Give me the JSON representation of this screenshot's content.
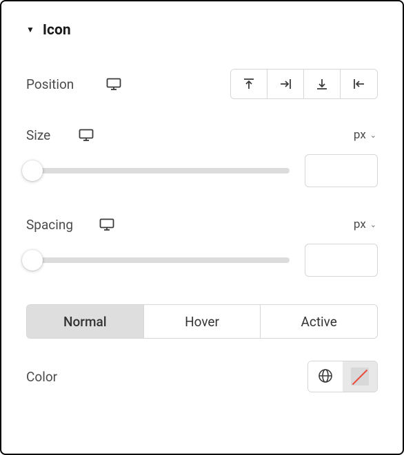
{
  "section": {
    "title": "Icon"
  },
  "position": {
    "label": "Position",
    "options": [
      "top",
      "right",
      "bottom",
      "left"
    ],
    "selected": null
  },
  "size": {
    "label": "Size",
    "unit": "px",
    "value": ""
  },
  "spacing": {
    "label": "Spacing",
    "unit": "px",
    "value": ""
  },
  "state_tabs": {
    "items": [
      "Normal",
      "Hover",
      "Active"
    ],
    "active_index": 0
  },
  "color": {
    "label": "Color",
    "value": null
  }
}
